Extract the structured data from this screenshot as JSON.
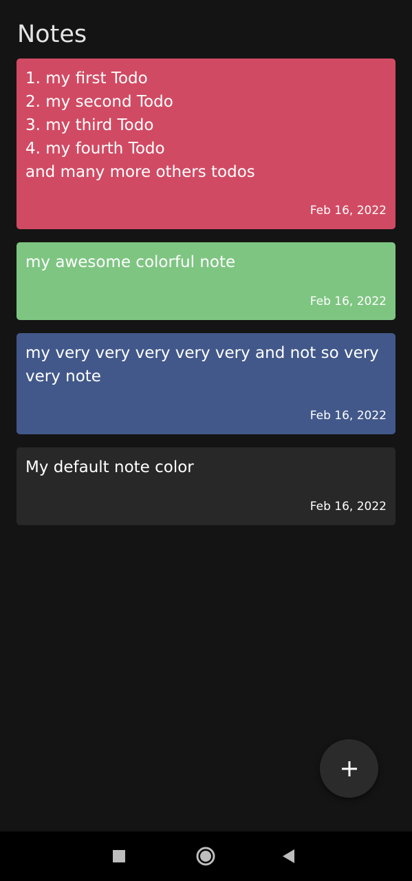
{
  "header": {
    "title": "Notes"
  },
  "notes": [
    {
      "text": "1. my first Todo\n2. my second Todo\n3. my third Todo\n4. my fourth Todo\nand many more others todos",
      "date": "Feb 16, 2022",
      "color": "#d14a63"
    },
    {
      "text": "my awesome colorful note",
      "date": "Feb 16, 2022",
      "color": "#7ec582"
    },
    {
      "text": "my very very very very very and not so very very note",
      "date": "Feb 16, 2022",
      "color": "#42588a"
    },
    {
      "text": "My default note color",
      "date": "Feb 16, 2022",
      "color": "#282828"
    }
  ],
  "fab": {
    "icon": "plus-icon"
  },
  "navigation_bar": {
    "recents_icon": "square-icon",
    "home_icon": "circle-icon",
    "back_icon": "triangle-back-icon"
  },
  "colors": {
    "background": "#141414",
    "fab": "#2b2b2b",
    "nav_bar": "#000000"
  }
}
